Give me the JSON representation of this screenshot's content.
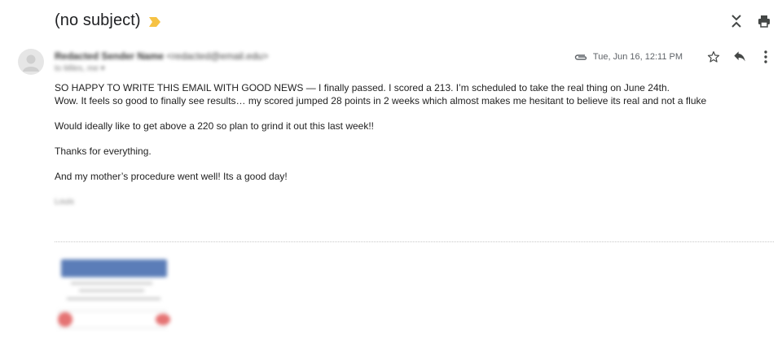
{
  "email": {
    "subject": "(no subject)",
    "sender_name": "Redacted Sender Name",
    "sender_email": "<redacted@email.edu>",
    "recipient": "to Miles, me",
    "date": "Tue, Jun 16, 12:11 PM"
  },
  "body": {
    "line1": "SO HAPPY TO WRITE THIS EMAIL WITH GOOD NEWS — I finally passed. I scored a 213. I’m scheduled to take the real thing on June 24th.",
    "line2": "Wow. It feels so good to finally see results… my scored jumped 28 points in 2 weeks which almost makes me hesitant to believe its real and not a fluke",
    "line3": "Would ideally like to get above a 220 so plan to grind it out this last week!!",
    "line4": "Thanks for everything.",
    "line5": "And my mother’s procedure went well! Its a good day!",
    "signature": "Louis"
  },
  "icons": {
    "importance": "importance-marker-icon",
    "collapse": "collapse-all-icon",
    "print": "print-icon",
    "attachment": "paperclip-icon",
    "star": "star-icon",
    "reply": "reply-icon",
    "more": "more-vert-icon",
    "avatar": "avatar-icon"
  },
  "colors": {
    "importance": "#f6c244",
    "icon": "#444746",
    "attachment_header": "#5b7db8"
  }
}
